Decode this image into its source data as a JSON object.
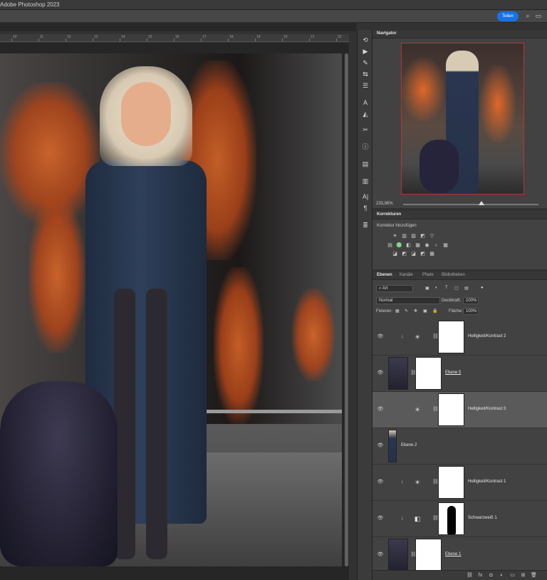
{
  "app": {
    "title": "Adobe Photoshop 2023"
  },
  "header": {
    "share_label": "Teilen",
    "icons": [
      "search-icon",
      "window-icon"
    ]
  },
  "ruler": {
    "labels": [
      "10",
      "11",
      "12",
      "13",
      "14",
      "15",
      "16",
      "17",
      "18",
      "19",
      "20",
      "21",
      "22"
    ]
  },
  "toolbar": {
    "tools": [
      "history-icon",
      "play-icon",
      "brush-settings-icon",
      "adjust-icon",
      "paragraph-icon",
      "character-icon",
      "shape-icon",
      "transform-icon",
      "info-icon",
      "properties-icon",
      "libraries-icon",
      "text-icon",
      "paragraph-style-icon",
      "layer-comps-icon"
    ]
  },
  "navigator": {
    "tab": "Navigator",
    "zoom": "233,96%",
    "zoom_fraction": 0.6
  },
  "korrekturen": {
    "tab": "Korrekturen",
    "subtitle": "Korrektur hinzufügen",
    "icons_row1": [
      "☀",
      "▥",
      "▨",
      "◩",
      "▽"
    ],
    "icons_row2": [
      "▤",
      "♎",
      "◧",
      "▦",
      "◉",
      "♁",
      "▦"
    ],
    "icons_row3": [
      "◪",
      "◩",
      "◪",
      "◩",
      "▦"
    ]
  },
  "ebenen": {
    "tabs": [
      "Ebenen",
      "Kanäle",
      "Pfade",
      "Bibliotheken"
    ],
    "filter_label": "Art",
    "blend_mode": "Normal",
    "opacity_label": "Deckkraft:",
    "opacity_value": "100%",
    "lock_label": "Fixieren:",
    "fill_label": "Fläche:",
    "fill_value": "100%",
    "layers": [
      {
        "name": "Helligkeit/Kontrast 2",
        "type": "adjustment",
        "clipped": true,
        "selected": false,
        "underline": false
      },
      {
        "name": "Ebene 5",
        "type": "pixel-mask",
        "clipped": false,
        "selected": false,
        "underline": true
      },
      {
        "name": "Helligkeit/Kontrast 3",
        "type": "adjustment",
        "clipped": false,
        "selected": true,
        "underline": false
      },
      {
        "name": "Ebene 2",
        "type": "pixel",
        "clipped": false,
        "selected": false,
        "underline": false
      },
      {
        "name": "Helligkeit/Kontrast 1",
        "type": "adjustment",
        "clipped": true,
        "selected": false,
        "underline": false
      },
      {
        "name": "Schwarzweiß 1",
        "type": "bw",
        "clipped": true,
        "selected": false,
        "underline": false
      },
      {
        "name": "Ebene 1",
        "type": "pixel-mask",
        "clipped": false,
        "selected": false,
        "underline": true
      }
    ]
  },
  "bottom_icons": [
    "link-icon",
    "fx-icon",
    "mask-icon",
    "adjustment-icon",
    "group-icon",
    "new-layer-icon",
    "trash-icon"
  ]
}
